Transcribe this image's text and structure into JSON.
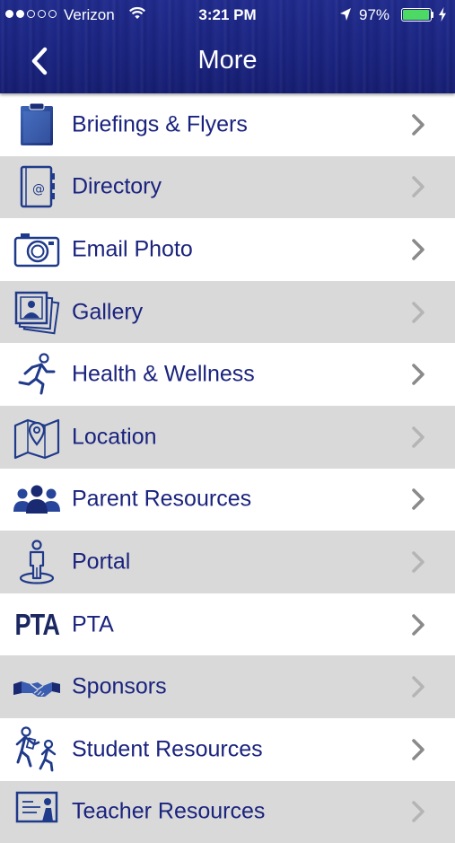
{
  "status_bar": {
    "carrier": "Verizon",
    "time": "3:21 PM",
    "battery_percent": "97%",
    "battery_level": 0.97,
    "signal_bars_filled": 2,
    "signal_bars_total": 5,
    "battery_color": "#4cd964"
  },
  "nav": {
    "title": "More",
    "back_icon": "chevron-left-icon"
  },
  "theme": {
    "header_color": "#1a2481",
    "label_color": "#1a237e",
    "row_alt_color": "#d9d9d9"
  },
  "menu": {
    "items": [
      {
        "label": "Briefings & Flyers",
        "icon": "clipboard-icon"
      },
      {
        "label": "Directory",
        "icon": "address-book-icon"
      },
      {
        "label": "Email Photo",
        "icon": "camera-icon"
      },
      {
        "label": "Gallery",
        "icon": "photo-stack-icon"
      },
      {
        "label": "Health & Wellness",
        "icon": "running-person-icon"
      },
      {
        "label": "Location",
        "icon": "map-pin-icon"
      },
      {
        "label": "Parent Resources",
        "icon": "people-group-icon"
      },
      {
        "label": "Portal",
        "icon": "person-portal-icon"
      },
      {
        "label": "PTA",
        "icon": "pta-logo-icon",
        "icon_text": "PTA"
      },
      {
        "label": "Sponsors",
        "icon": "handshake-icon"
      },
      {
        "label": "Student Resources",
        "icon": "students-walking-icon"
      },
      {
        "label": "Teacher Resources",
        "icon": "teacher-board-icon"
      }
    ]
  }
}
